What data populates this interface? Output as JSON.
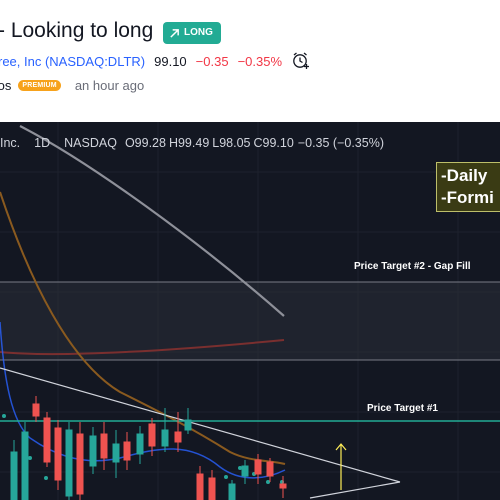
{
  "header": {
    "title": "- Looking to long",
    "badge": "LONG",
    "symbol_link": "ree, Inc (NASDAQ:DLTR)",
    "price": "99.10",
    "change": "−0.35",
    "change_pct": "−0.35%",
    "alert_icon": "add-alert-clock-icon",
    "author": "tos",
    "premium_badge": "PREMIUM",
    "posted_time": "an hour ago"
  },
  "chart": {
    "legend": {
      "symbol": "Inc.",
      "interval": "1D",
      "exchange": "NASDAQ",
      "o_label": "O",
      "o_val": "99.28",
      "h_label": "H",
      "h_val": "99.49",
      "l_label": "L",
      "l_val": "98.05",
      "c_label": "C",
      "c_val": "99.10",
      "chg": "−0.35 (−0.35%)"
    },
    "annotation_lines": [
      "-Daily",
      "-Formi"
    ],
    "price_target_2": "Price Target #2 - Gap Fill",
    "price_target_1": "Price Target #1",
    "colors": {
      "background": "#131722",
      "up_candle": "#26a69a",
      "down_candle": "#ef5350",
      "target_line": "#22ab94",
      "badge": "#22ab94",
      "premium": "#f7a21b",
      "negative": "#f23645",
      "link": "#2962ff"
    }
  }
}
